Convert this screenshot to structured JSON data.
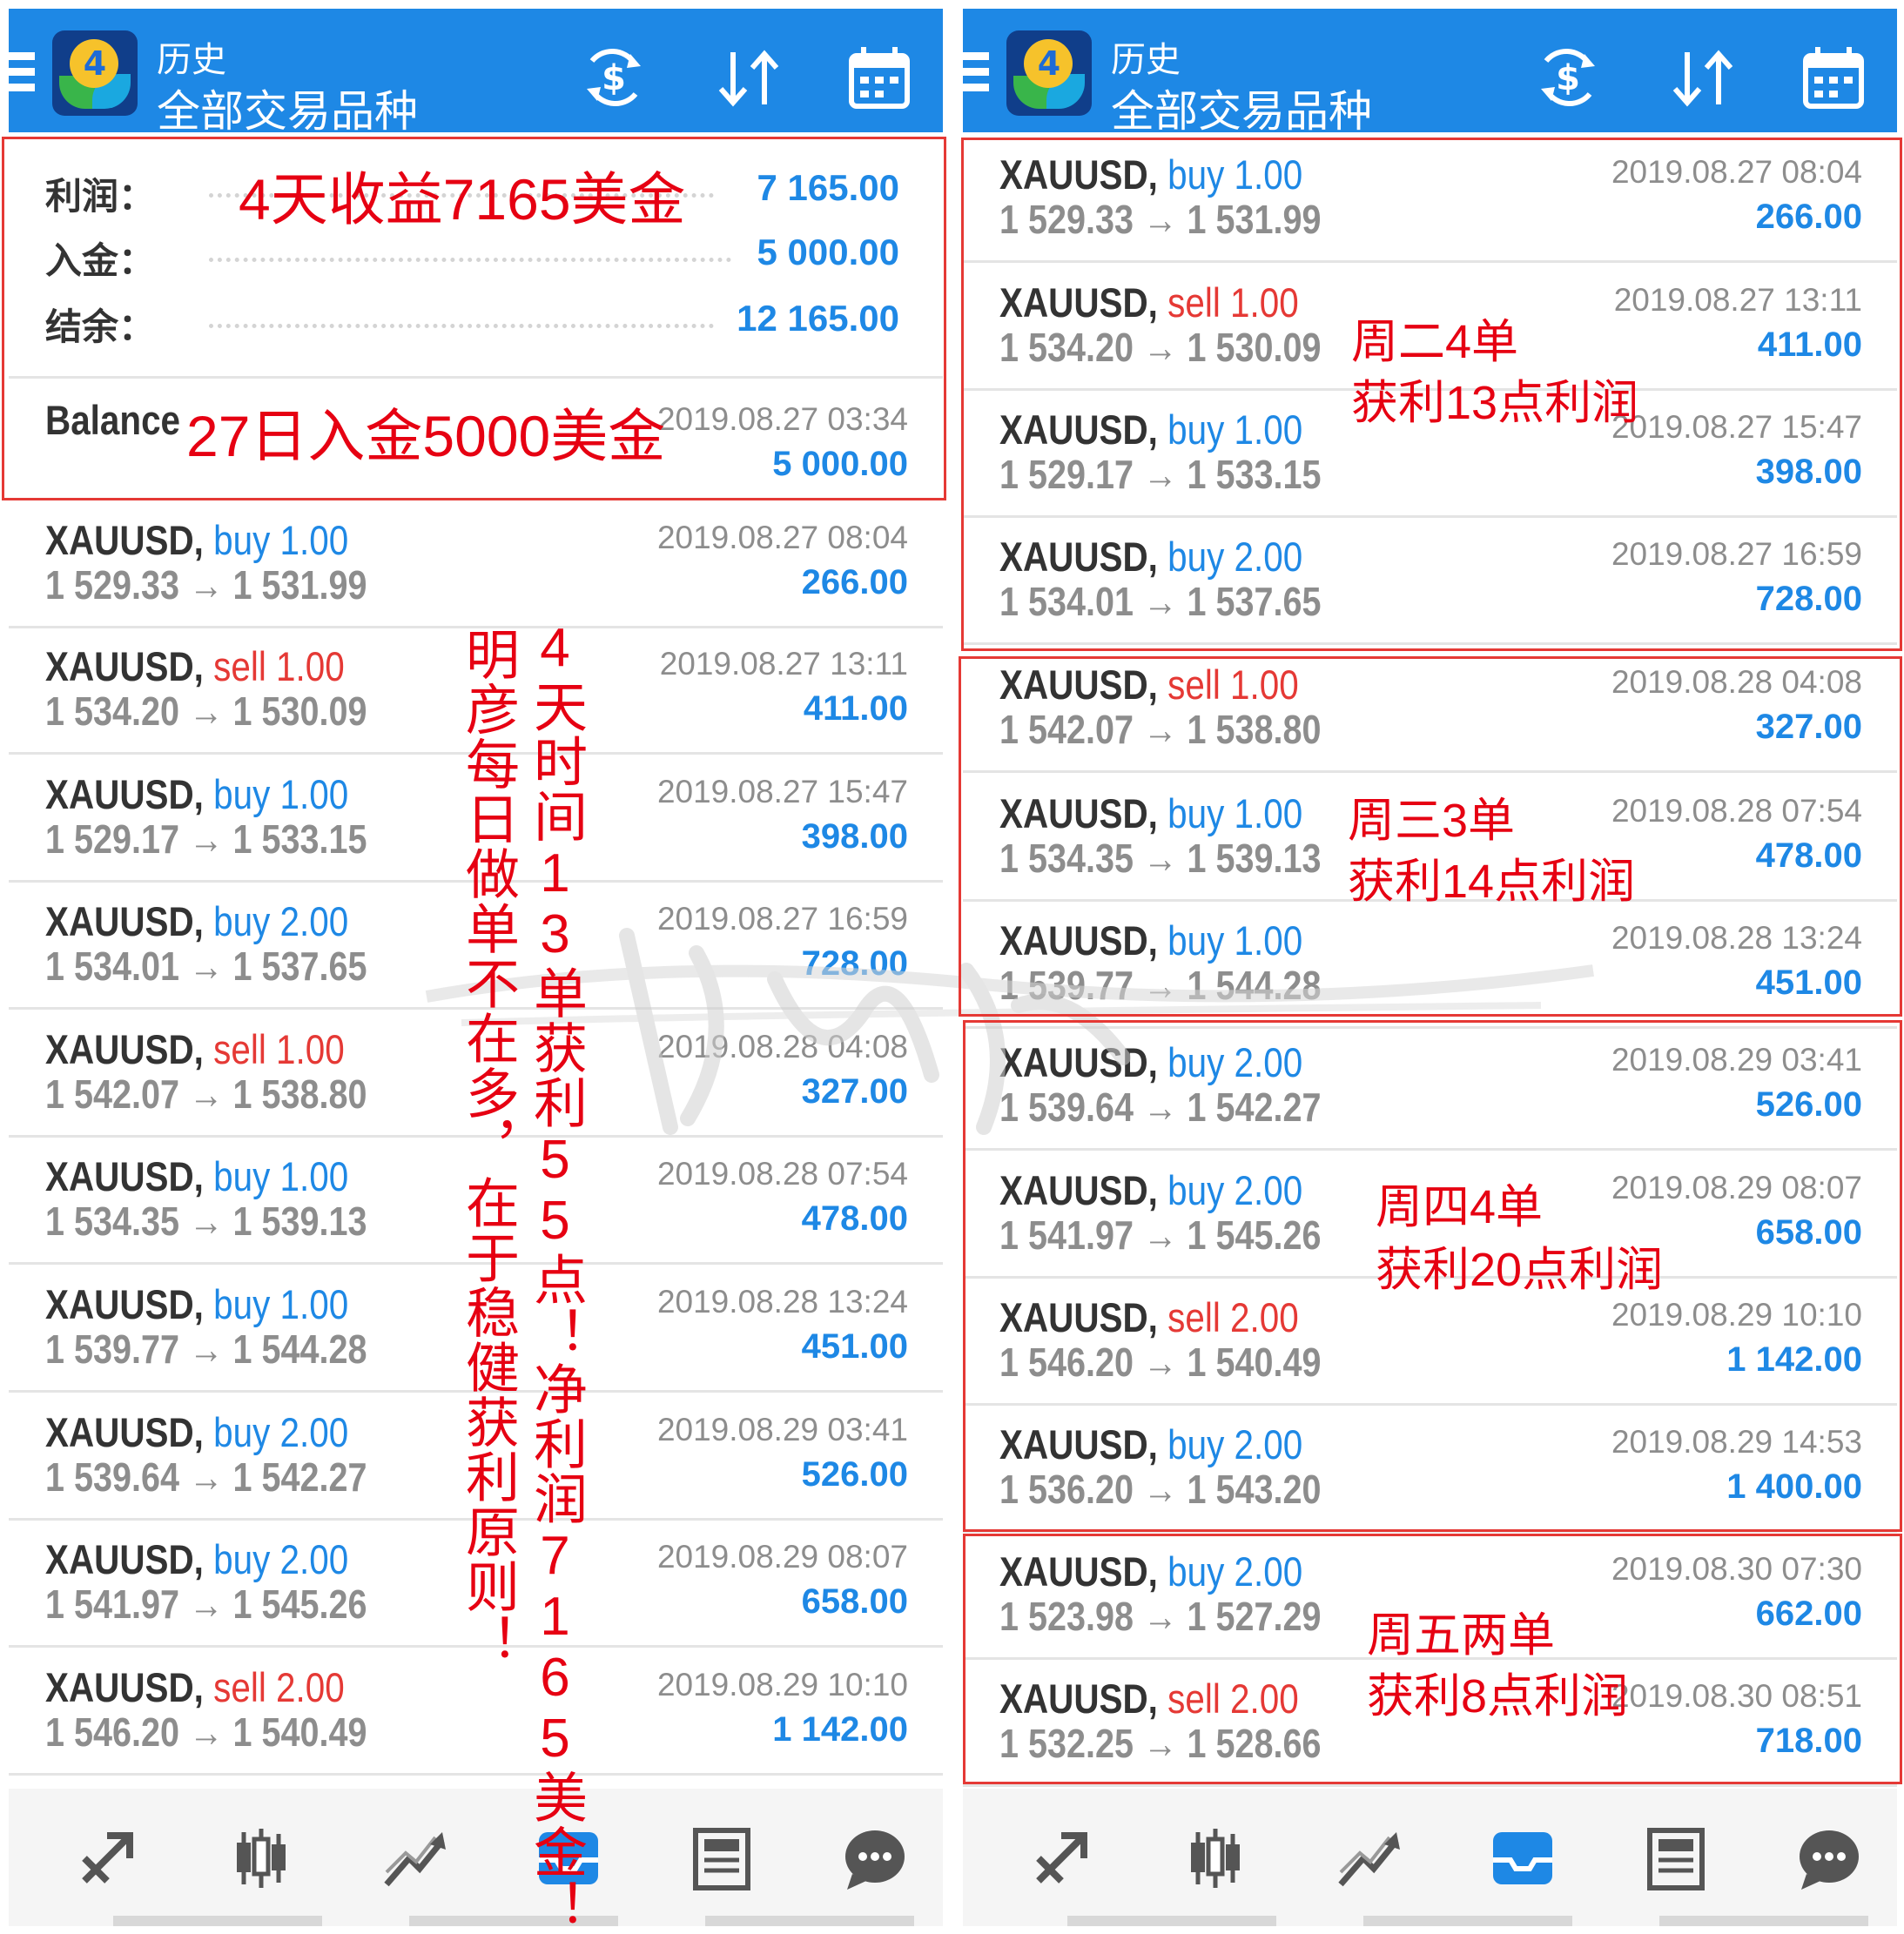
{
  "header": {
    "subtitle": "历史",
    "title": "全部交易品种"
  },
  "toolbar_icons": [
    "currency-exchange-icon",
    "sort-icon",
    "calendar-icon"
  ],
  "summary": {
    "profit_label": "利润：",
    "profit_value": "7 165.00",
    "deposit_label": "入金：",
    "deposit_value": "5 000.00",
    "balance_label": "结余：",
    "balance_value": "12 165.00"
  },
  "balance_entry": {
    "label": "Balance",
    "date": "2019.08.27 03:34",
    "amount": "5 000.00"
  },
  "deals": [
    {
      "symbol": "XAUUSD,",
      "side": "buy",
      "volume": "1.00",
      "prices": "1 529.33 → 1 531.99",
      "date": "2019.08.27 08:04",
      "profit": "266.00"
    },
    {
      "symbol": "XAUUSD,",
      "side": "sell",
      "volume": "1.00",
      "prices": "1 534.20 → 1 530.09",
      "date": "2019.08.27 13:11",
      "profit": "411.00"
    },
    {
      "symbol": "XAUUSD,",
      "side": "buy",
      "volume": "1.00",
      "prices": "1 529.17 → 1 533.15",
      "date": "2019.08.27 15:47",
      "profit": "398.00"
    },
    {
      "symbol": "XAUUSD,",
      "side": "buy",
      "volume": "2.00",
      "prices": "1 534.01 → 1 537.65",
      "date": "2019.08.27 16:59",
      "profit": "728.00"
    },
    {
      "symbol": "XAUUSD,",
      "side": "sell",
      "volume": "1.00",
      "prices": "1 542.07 → 1 538.80",
      "date": "2019.08.28 04:08",
      "profit": "327.00"
    },
    {
      "symbol": "XAUUSD,",
      "side": "buy",
      "volume": "1.00",
      "prices": "1 534.35 → 1 539.13",
      "date": "2019.08.28 07:54",
      "profit": "478.00"
    },
    {
      "symbol": "XAUUSD,",
      "side": "buy",
      "volume": "1.00",
      "prices": "1 539.77 → 1 544.28",
      "date": "2019.08.28 13:24",
      "profit": "451.00"
    },
    {
      "symbol": "XAUUSD,",
      "side": "buy",
      "volume": "2.00",
      "prices": "1 539.64 → 1 542.27",
      "date": "2019.08.29 03:41",
      "profit": "526.00"
    },
    {
      "symbol": "XAUUSD,",
      "side": "buy",
      "volume": "2.00",
      "prices": "1 541.97 → 1 545.26",
      "date": "2019.08.29 08:07",
      "profit": "658.00"
    },
    {
      "symbol": "XAUUSD,",
      "side": "sell",
      "volume": "2.00",
      "prices": "1 546.20 → 1 540.49",
      "date": "2019.08.29 10:10",
      "profit": "1 142.00"
    },
    {
      "symbol": "XAUUSD,",
      "side": "buy",
      "volume": "2.00",
      "prices": "1 536.20 → 1 543.20",
      "date": "2019.08.29 14:53",
      "profit": "1 400.00"
    },
    {
      "symbol": "XAUUSD,",
      "side": "buy",
      "volume": "2.00",
      "prices": "1 523.98 → 1 527.29",
      "date": "2019.08.30 07:30",
      "profit": "662.00"
    },
    {
      "symbol": "XAUUSD,",
      "side": "sell",
      "volume": "2.00",
      "prices": "1 532.25 → 1 528.66",
      "date": "2019.08.30 08:51",
      "profit": "718.00"
    }
  ],
  "annotations": {
    "profit_note": "4天收益7165美金",
    "deposit_note": "27日入金5000美金",
    "vertical_1": "4天时间13单获利55点！净利润7165美金！",
    "vertical_2": "明彦每日做单不在多，在于稳健获利原则！",
    "tue_1": "周二4单",
    "tue_2": "获利13点利润",
    "wed_1": "周三3单",
    "wed_2": "获利14点利润",
    "thu_1": "周四4单",
    "thu_2": "获利20点利润",
    "fri_1": "周五两单",
    "fri_2": "获利8点利润"
  },
  "bottom_nav": [
    "quotes-icon",
    "chart-icon",
    "trade-icon",
    "history-icon",
    "news-icon",
    "messages-icon"
  ],
  "colors": {
    "appbar": "#1e88e5",
    "buy": "#1e88e5",
    "sell": "#e53935",
    "annotation": "#e60012"
  }
}
